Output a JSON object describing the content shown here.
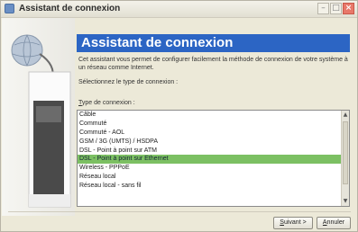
{
  "window": {
    "title": "Assistant de connexion",
    "controls": {
      "minimize": "–",
      "maximize": "□",
      "close": "×"
    }
  },
  "header": {
    "title": "Assistant de connexion"
  },
  "body": {
    "description": "Cet assistant vous permet de configurer facilement la méthode de connexion de votre système à un réseau comme Internet.",
    "instruction": "Sélectionnez le type de connexion :",
    "list_label_accel": "T",
    "list_label_rest": "ype de connexion :"
  },
  "connection_types": [
    {
      "label": "Câble"
    },
    {
      "label": "Commuté"
    },
    {
      "label": "Commuté - AOL"
    },
    {
      "label": "GSM / 3G (UMTS) / HSDPA"
    },
    {
      "label": "DSL - Point à point sur ATM"
    },
    {
      "label": "DSL - Point à point sur Ethernet",
      "selected": true
    },
    {
      "label": "Wireless - PPPoE"
    },
    {
      "label": "Réseau local"
    },
    {
      "label": "Réseau local - sans fil"
    }
  ],
  "buttons": {
    "next_accel": "S",
    "next_rest": "uivant",
    "next_suffix": " >",
    "cancel_accel": "A",
    "cancel_rest": "nnuler"
  },
  "colors": {
    "header_bg": "#2c65c4",
    "selection_bg": "#7cc063"
  }
}
